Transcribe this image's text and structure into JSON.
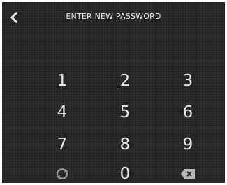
{
  "header": {
    "title": "ENTER NEW PASSWORD",
    "back_icon": "chevron-left-icon"
  },
  "keypad": {
    "keys": [
      "1",
      "2",
      "3",
      "4",
      "5",
      "6",
      "7",
      "8",
      "9",
      "0"
    ],
    "refresh_icon": "refresh-icon",
    "delete_icon": "backspace-icon"
  },
  "colors": {
    "background": "#262626",
    "text": "#e6e6e6",
    "icon": "#9a9a9a"
  }
}
